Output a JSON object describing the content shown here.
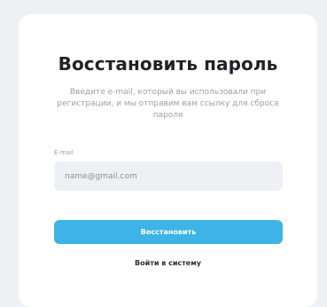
{
  "card": {
    "title": "Восстановить пароль",
    "subtitle": "Введите e-mail, который вы использовали при регистрации, и мы отправим вам ссылку для сброса пароля",
    "email_label": "E-mail",
    "email_placeholder": "name@gmail.com",
    "email_value": "",
    "submit_label": "Восстановить",
    "login_link": "Войти в систему"
  },
  "colors": {
    "background": "#eef0f4",
    "card": "#ffffff",
    "accent": "#3db4e5",
    "text": "#1f2228",
    "muted": "#9aa0aa"
  }
}
